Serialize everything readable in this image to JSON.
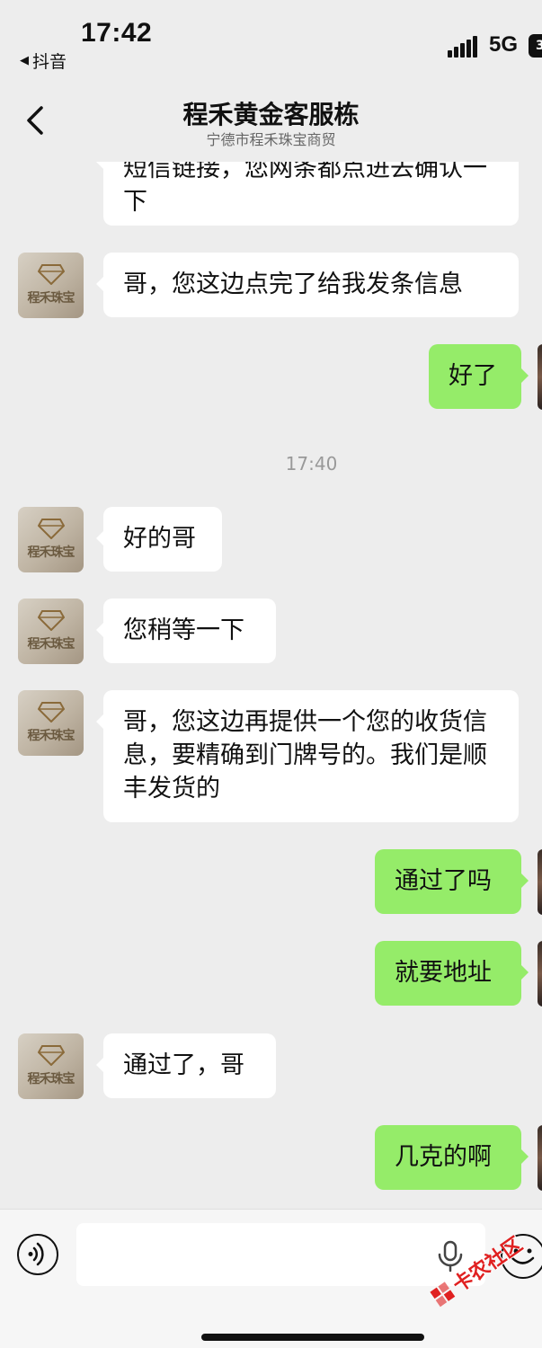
{
  "status_bar": {
    "time": "17:42",
    "back_app": "抖音",
    "network": "5G",
    "battery": "3"
  },
  "header": {
    "title": "程禾黄金客服栋",
    "subtitle": "宁德市程禾珠宝商贸"
  },
  "avatar_brand": "程禾珠宝",
  "messages": [
    {
      "side": "left",
      "text": "短信链接，您网条都点进去确认一下"
    },
    {
      "side": "left",
      "text": "哥，您这边点完了给我发条信息"
    },
    {
      "side": "right",
      "text": "好了"
    },
    {
      "type": "time",
      "text": "17:40"
    },
    {
      "side": "left",
      "text": "好的哥"
    },
    {
      "side": "left",
      "text": "您稍等一下"
    },
    {
      "side": "left",
      "text": "哥，您这边再提供一个您的收货信息，要精确到门牌号的。我们是顺丰发货的"
    },
    {
      "side": "right",
      "text": "通过了吗"
    },
    {
      "side": "right",
      "text": "就要地址"
    },
    {
      "side": "left",
      "text": "通过了，哥"
    },
    {
      "side": "right",
      "text": "几克的啊"
    }
  ],
  "input": {
    "placeholder": ""
  },
  "watermark": "卡农社区"
}
